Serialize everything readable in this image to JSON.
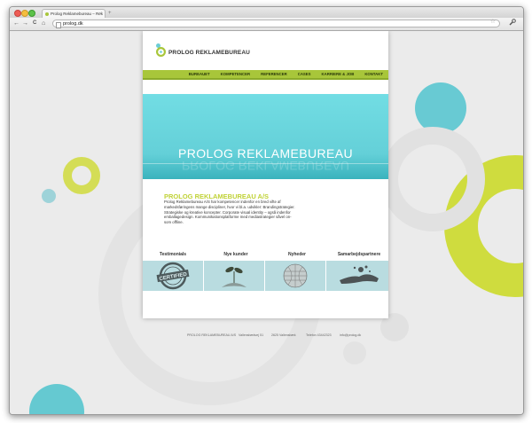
{
  "browser": {
    "tab_title": "Prolog Reklamebureau – Rek",
    "tab_close": "×",
    "new_tab": "+",
    "back": "←",
    "forward": "→",
    "reload": "C",
    "home": "⌂",
    "url": "prolog.dk",
    "star": "☆",
    "wrench": "🔧"
  },
  "site": {
    "logo_text": "PROLOG REKLAMEBUREAU",
    "nav": [
      "BUREAUET",
      "KOMPETENCER",
      "REFERENCER",
      "CASES",
      "KARRIERE & JOB",
      "KONTAKT"
    ],
    "hero_title": "PROLOG REKLAMEBUREAU",
    "intro_heading": "PROLOG REKLAMEBUREAU A/S",
    "intro_text": "Prolog Reklamebureau A/S har kompetencer indenfor en bred vifte af markedsføringens mange discipliner, hvor vi bl.a. udvikler: Brandingstrategier. Strategiske og kreative koncepter. Corporate visual identity – også indenfor emballagedesign. Kommunikationsplatforme med mediastrategier såvel on- som offline.",
    "features": [
      "Testimonials",
      "Nye kunder",
      "Nyheder",
      "Samarbejdspartnere"
    ],
    "certified": "CERTIFIED",
    "footer": {
      "company": "PROLOG REKLAMEBUREAU A/S",
      "street": "Vallensbækvej 51",
      "city": "2625 Vallensbæk",
      "phone": "Telefon 43442323",
      "email": "info@prolog.dk"
    }
  },
  "colors": {
    "accent_green": "#a8c63a",
    "accent_cyan": "#6ccdd6",
    "lime": "#cfdc3e"
  }
}
